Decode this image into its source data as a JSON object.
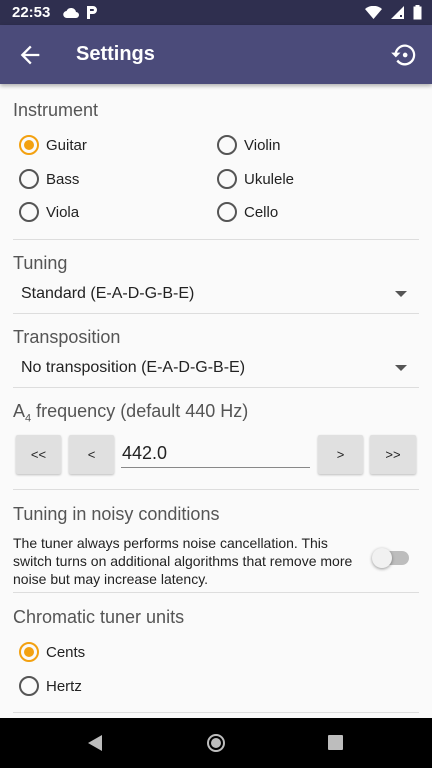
{
  "status_bar": {
    "time": "22:53",
    "left_icons": [
      "cloud-icon",
      "parking-icon"
    ],
    "right_icons": [
      "wifi-icon",
      "signal-icon",
      "battery-icon"
    ]
  },
  "app_bar": {
    "title": "Settings"
  },
  "instrument": {
    "title": "Instrument",
    "options": [
      {
        "label": "Guitar",
        "checked": true
      },
      {
        "label": "Violin",
        "checked": false
      },
      {
        "label": "Bass",
        "checked": false
      },
      {
        "label": "Ukulele",
        "checked": false
      },
      {
        "label": "Viola",
        "checked": false
      },
      {
        "label": "Cello",
        "checked": false
      }
    ]
  },
  "tuning": {
    "title": "Tuning",
    "value": "Standard (E-A-D-G-B-E)"
  },
  "transposition": {
    "title": "Transposition",
    "value": "No transposition (E-A-D-G-B-E)"
  },
  "frequency": {
    "title_prefix": "A",
    "title_sub": "4",
    "title_suffix": " frequency (default 440 Hz)",
    "buttons": {
      "fast_down": "<<",
      "down": "<",
      "up": ">",
      "fast_up": ">>"
    },
    "value": "442.0"
  },
  "noise": {
    "title": "Tuning in noisy conditions",
    "description": "The tuner always performs noise cancellation. This switch turns on additional algorithms that remove more noise but may increase latency.",
    "enabled": false
  },
  "chromatic_units": {
    "title": "Chromatic tuner units",
    "options": [
      {
        "label": "Cents",
        "checked": true
      },
      {
        "label": "Hertz",
        "checked": false
      }
    ]
  },
  "colors": {
    "accent": "#f3a110",
    "app_bar": "#4b4b7a",
    "status_bar": "#2f2f4f"
  }
}
